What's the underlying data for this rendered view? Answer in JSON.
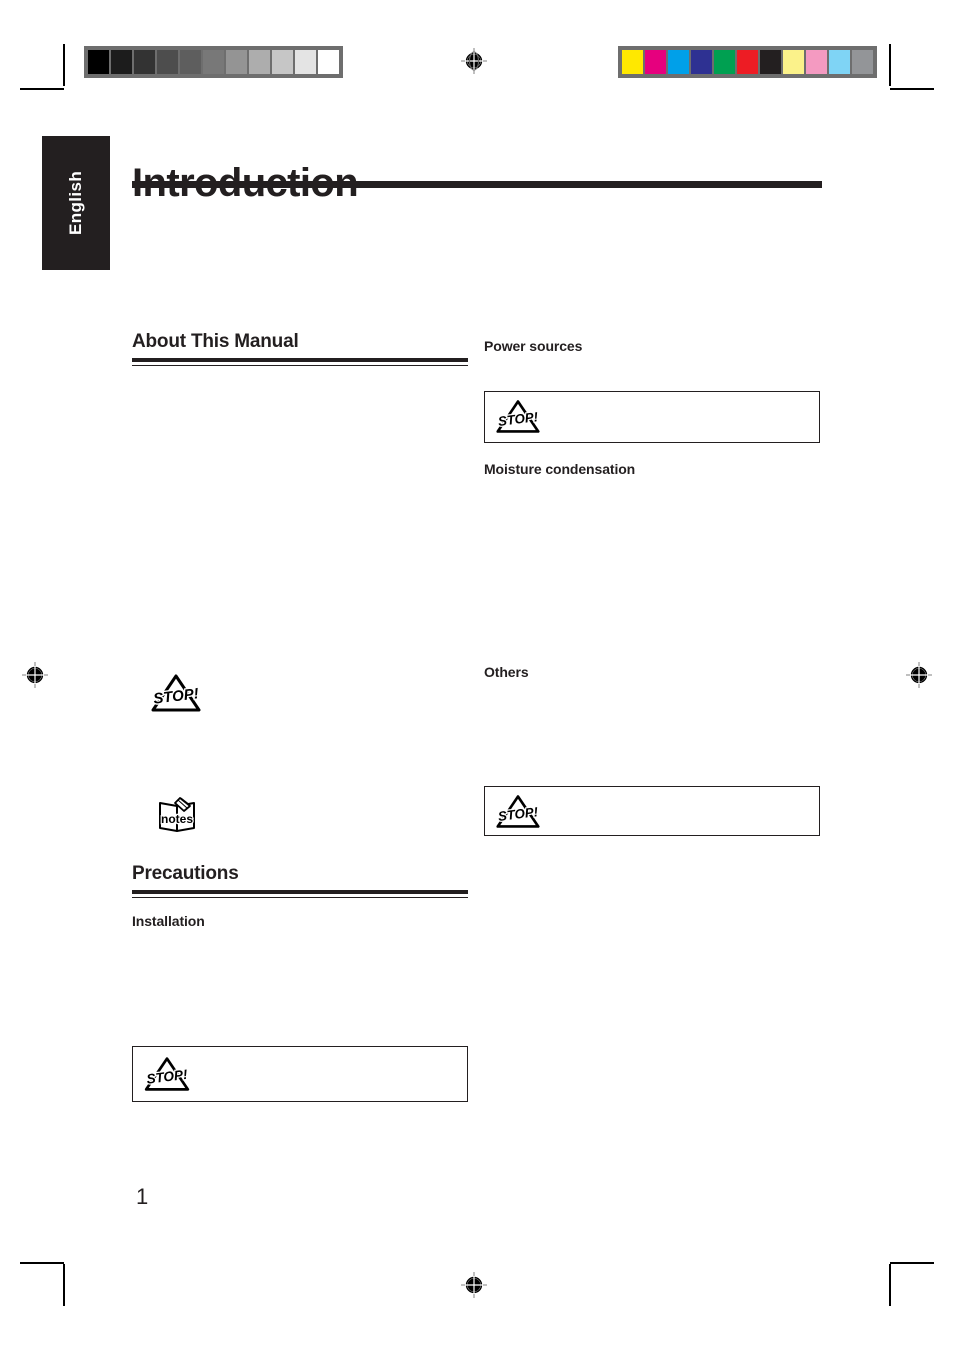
{
  "document": {
    "page_title": "Introduction",
    "language_tab": "English",
    "page_number": "1"
  },
  "left_column": {
    "section_1": {
      "heading": "About This Manual",
      "callouts": [
        {
          "icon": "stop-icon",
          "boxed": false
        },
        {
          "icon": "notes-icon",
          "boxed": false
        }
      ]
    },
    "section_2": {
      "heading": "Precautions",
      "sub_heading": "Installation",
      "callouts": [
        {
          "icon": "stop-icon",
          "boxed": true
        }
      ]
    }
  },
  "right_column": {
    "sub_heading_1": "Power sources",
    "callout_1": {
      "icon": "stop-icon",
      "boxed": true
    },
    "sub_heading_2": "Moisture condensation",
    "sub_heading_3": "Others",
    "callout_2": {
      "icon": "stop-icon",
      "boxed": true
    }
  },
  "icons": {
    "stop_label": "STOP!",
    "notes_label": "notes"
  },
  "prepress": {
    "grayscale_strip": [
      "#000000",
      "#1c1c1c",
      "#333333",
      "#4d4d4d",
      "#5e5e5e",
      "#787878",
      "#949494",
      "#adadad",
      "#c6c6c6",
      "#e4e4e4",
      "#ffffff"
    ],
    "color_strip": [
      "#ffe800",
      "#e6007e",
      "#00a0e9",
      "#2e3192",
      "#00a051",
      "#ed1c24",
      "#231f20",
      "#fbf28a",
      "#f49ac1",
      "#7fd4f5",
      "#939598"
    ],
    "registration_marks": 4,
    "crop_marks": 8
  }
}
